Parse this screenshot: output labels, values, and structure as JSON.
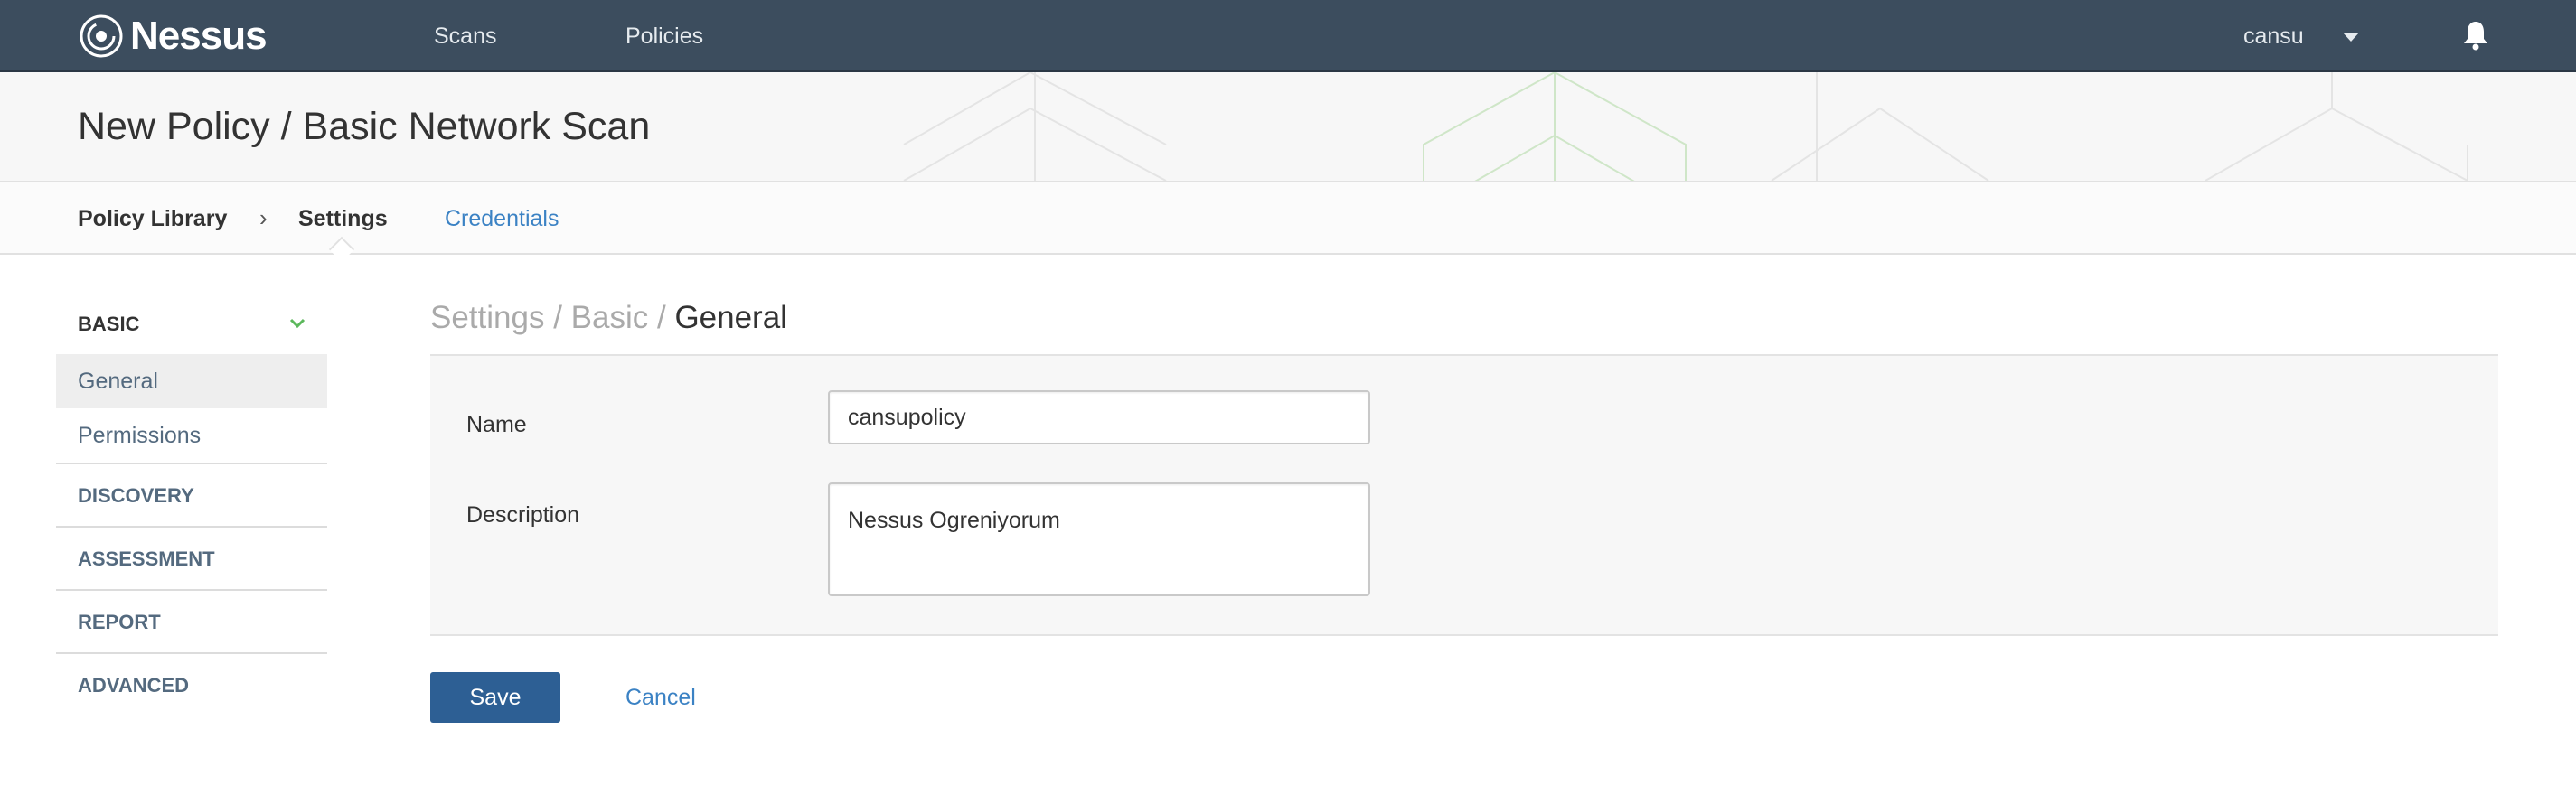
{
  "app": {
    "name": "Nessus"
  },
  "topnav": {
    "links": [
      "Scans",
      "Policies"
    ],
    "user": "cansu"
  },
  "page": {
    "title": "New Policy / Basic Network Scan"
  },
  "breadcrumb": {
    "library": "Policy Library",
    "separator": "›",
    "current": "Settings",
    "tab_credentials": "Credentials"
  },
  "sidebar": {
    "section_basic": "BASIC",
    "items": [
      "General",
      "Permissions"
    ],
    "sections": [
      "DISCOVERY",
      "ASSESSMENT",
      "REPORT",
      "ADVANCED"
    ]
  },
  "main": {
    "crumb_settings": "Settings",
    "crumb_sep": " / ",
    "crumb_basic": "Basic",
    "crumb_current": "General"
  },
  "form": {
    "name_label": "Name",
    "name_value": "cansupolicy",
    "description_label": "Description",
    "description_value": "Nessus Ogreniyorum"
  },
  "actions": {
    "save": "Save",
    "cancel": "Cancel"
  },
  "colors": {
    "nav_bg": "#3c4d5e",
    "accent_link": "#3b82c4",
    "save_button": "#2d5f94",
    "chevron_green": "#5cb85c"
  }
}
